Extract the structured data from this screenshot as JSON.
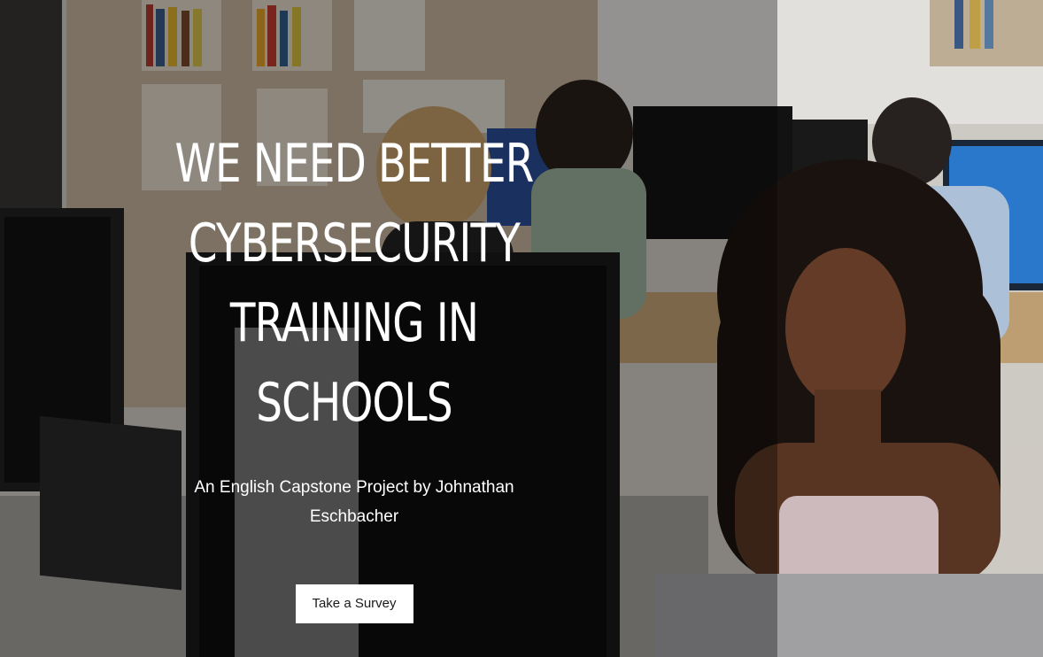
{
  "hero": {
    "headline_lines": [
      "WE NEED BETTER",
      "CYBERSECURITY",
      "TRAINING IN",
      "SCHOOLS"
    ],
    "subtitle": "An English Capstone Project by Johnathan Eschbacher",
    "cta_label": "Take a Survey"
  },
  "colors": {
    "overlay": "#000000",
    "button_bg": "#ffffff",
    "button_text": "#1a1a1a",
    "text": "#ffffff"
  }
}
